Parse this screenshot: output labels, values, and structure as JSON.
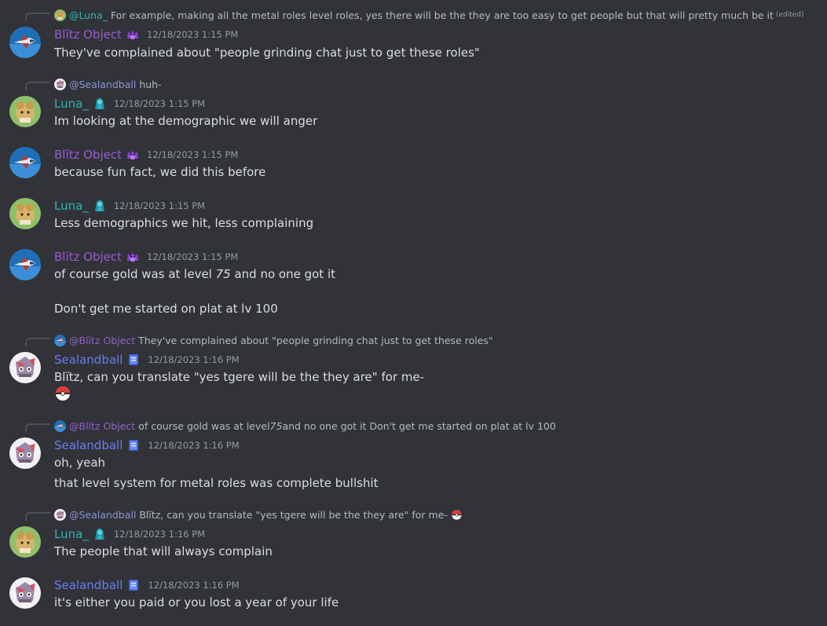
{
  "colors": {
    "background": "#313338",
    "blitz": "#9b59d0",
    "luna": "#2fb3b3",
    "sealandball": "#6b7cf0",
    "text": "#dbdee1",
    "muted": "#949ba4"
  },
  "messages": [
    {
      "reply": {
        "mention": "@Luna_",
        "text": "For example, making all the metal roles level roles, yes there will be the they are too easy to get people but that will pretty much be it",
        "edited": "(edited)"
      },
      "author": "Blïtz Object",
      "role_icon": "purple-cat-icon",
      "timestamp": "12/18/2023 1:15 PM",
      "lines": [
        "They've complained about \"people grinding chat just to get these roles\""
      ]
    },
    {
      "reply": {
        "mention": "@Sealandball",
        "text": "huh-"
      },
      "author": "Luna_",
      "role_icon": "teal-character-icon",
      "timestamp": "12/18/2023 1:15 PM",
      "lines": [
        "Im looking at the demographic we will anger"
      ]
    },
    {
      "author": "Blïtz Object",
      "role_icon": "purple-cat-icon",
      "timestamp": "12/18/2023 1:15 PM",
      "lines": [
        "because fun fact, we did this before"
      ]
    },
    {
      "author": "Luna_",
      "role_icon": "teal-character-icon",
      "timestamp": "12/18/2023 1:15 PM",
      "lines": [
        "Less demographics we hit, less complaining"
      ]
    },
    {
      "author": "Blïtz Object",
      "role_icon": "purple-cat-icon",
      "timestamp": "12/18/2023 1:15 PM",
      "line1_pre": "of course gold was at level ",
      "line1_em": "75",
      "line1_post": " and no one got it",
      "line2": "Don't get me started on plat at lv 100"
    },
    {
      "reply": {
        "mention": "@Blïtz Object",
        "text": "They've complained about \"people grinding chat just to get these roles\""
      },
      "author": "Sealandball",
      "role_icon": "blue-book-icon",
      "timestamp": "12/18/2023 1:16 PM",
      "lines": [
        "Blïtz, can you translate \"yes tgere will be the they are\" for me-"
      ],
      "emoji": "red-ball-emoji"
    },
    {
      "reply": {
        "mention": "@Blïtz Object",
        "text_pre": "of course gold was at level ",
        "text_em": "75",
        "text_post": " and no one got it Don't get me started on plat at lv 100"
      },
      "author": "Sealandball",
      "role_icon": "blue-book-icon",
      "timestamp": "12/18/2023 1:16 PM",
      "lines": [
        "oh, yeah",
        "that level system for metal roles was complete bullshit"
      ]
    },
    {
      "reply": {
        "mention": "@Sealandball",
        "text": "Blïtz, can you translate \"yes tgere will be the they are\" for me-",
        "emoji": "red-ball-emoji"
      },
      "author": "Luna_",
      "role_icon": "teal-character-icon",
      "timestamp": "12/18/2023 1:16 PM",
      "lines": [
        "The people that will always complain"
      ]
    },
    {
      "author": "Sealandball",
      "role_icon": "blue-book-icon",
      "timestamp": "12/18/2023 1:16 PM",
      "lines": [
        "it's either you paid or you lost a year of your life"
      ]
    }
  ]
}
